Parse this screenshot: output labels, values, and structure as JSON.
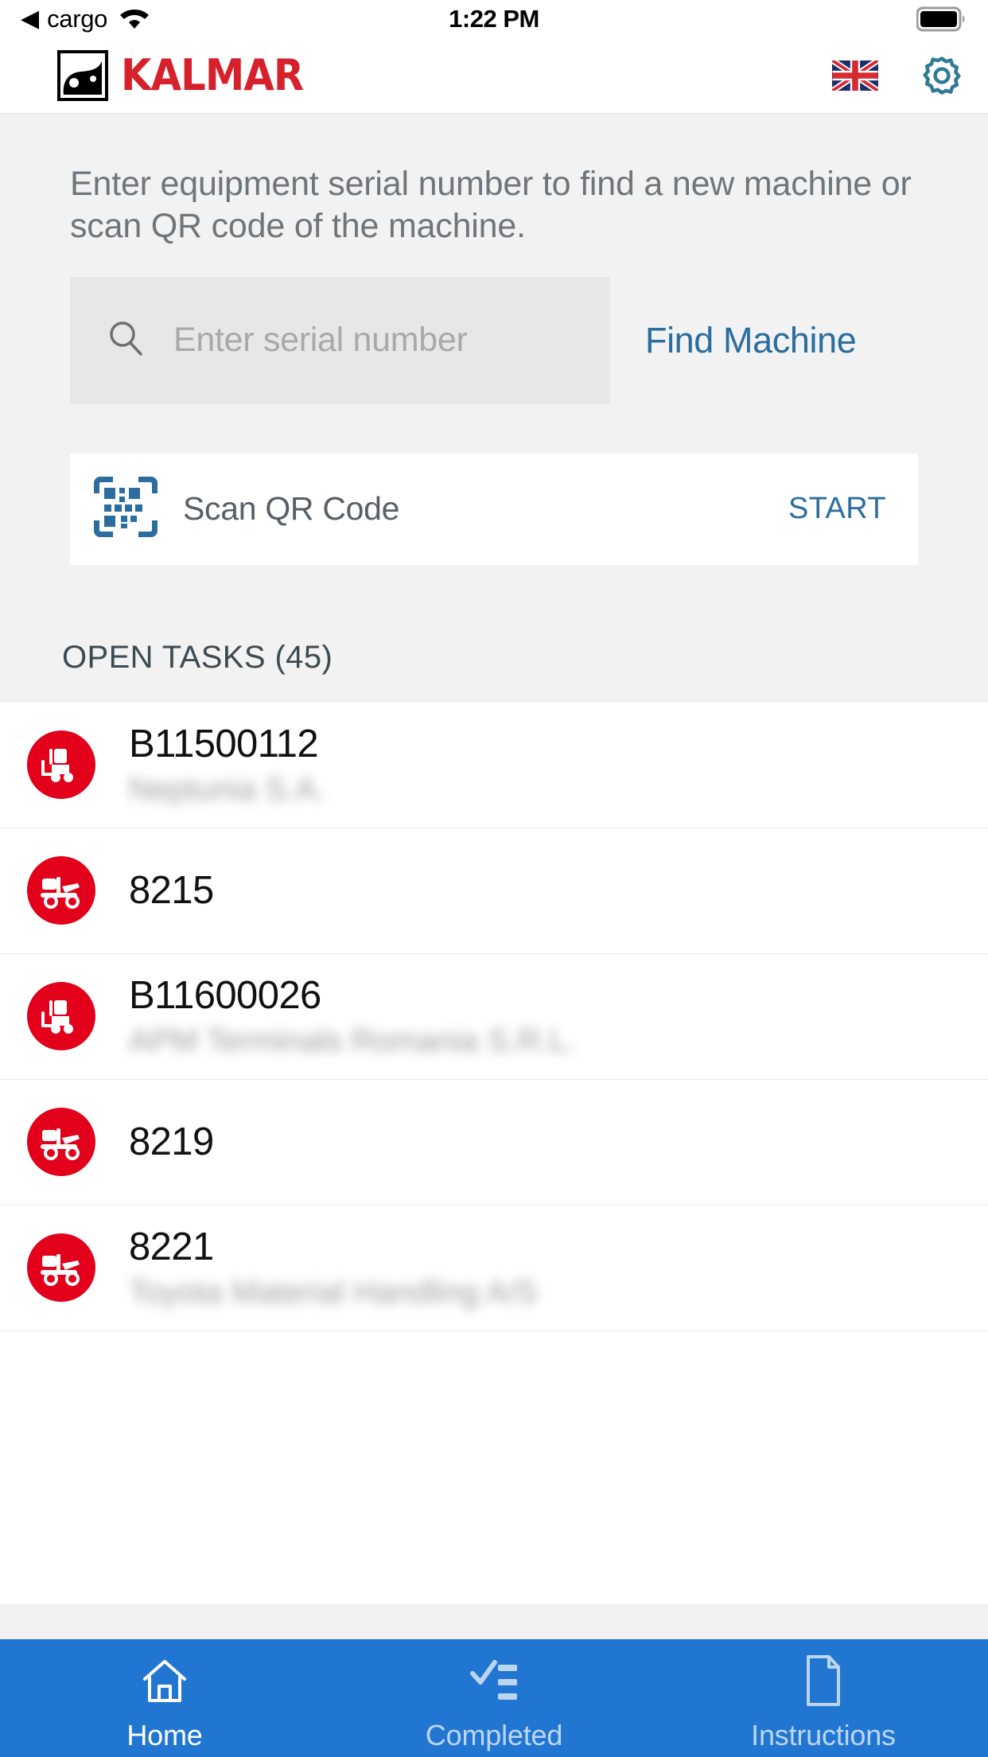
{
  "status_bar": {
    "back_icon": "back-triangle-icon",
    "carrier": "cargo",
    "wifi_icon": "wifi-icon",
    "time": "1:22 PM",
    "battery_icon": "battery-full-icon"
  },
  "app_bar": {
    "logo_mark_icon": "kalmar-elephant-logo-icon",
    "brand": "KALMAR",
    "brand_color": "#d6212d",
    "language_flag_icon": "uk-flag-icon",
    "settings_icon": "gear-icon",
    "settings_color": "#2f7b96"
  },
  "finder": {
    "instruction": "Enter equipment serial number to find a new machine or scan QR code of the machine.",
    "search_icon": "search-icon",
    "search_placeholder": "Enter serial number",
    "search_value": "",
    "find_label": "Find Machine",
    "link_color": "#2a6d9e"
  },
  "qr": {
    "icon": "qr-code-scan-icon",
    "label": "Scan QR Code",
    "action_label": "START"
  },
  "tasks": {
    "section_label": "OPEN TASKS (45)",
    "count": 45,
    "icon_bg": "#e2001a",
    "items": [
      {
        "icon": "forklift-icon",
        "title": "B11500112",
        "subtitle": "Neptunia S.A."
      },
      {
        "icon": "terminal-tractor-icon",
        "title": "8215",
        "subtitle": ""
      },
      {
        "icon": "forklift-icon",
        "title": "B11600026",
        "subtitle": "APM Terminals Romania S.R.L."
      },
      {
        "icon": "terminal-tractor-icon",
        "title": "8219",
        "subtitle": ""
      },
      {
        "icon": "terminal-tractor-icon",
        "title": "8221",
        "subtitle": "Toyota Material Handling A/S"
      }
    ]
  },
  "tab_bar": {
    "background": "#2176d2",
    "items": [
      {
        "icon": "home-icon",
        "label": "Home",
        "active": true
      },
      {
        "icon": "checklist-icon",
        "label": "Completed",
        "active": false
      },
      {
        "icon": "document-icon",
        "label": "Instructions",
        "active": false
      }
    ]
  }
}
